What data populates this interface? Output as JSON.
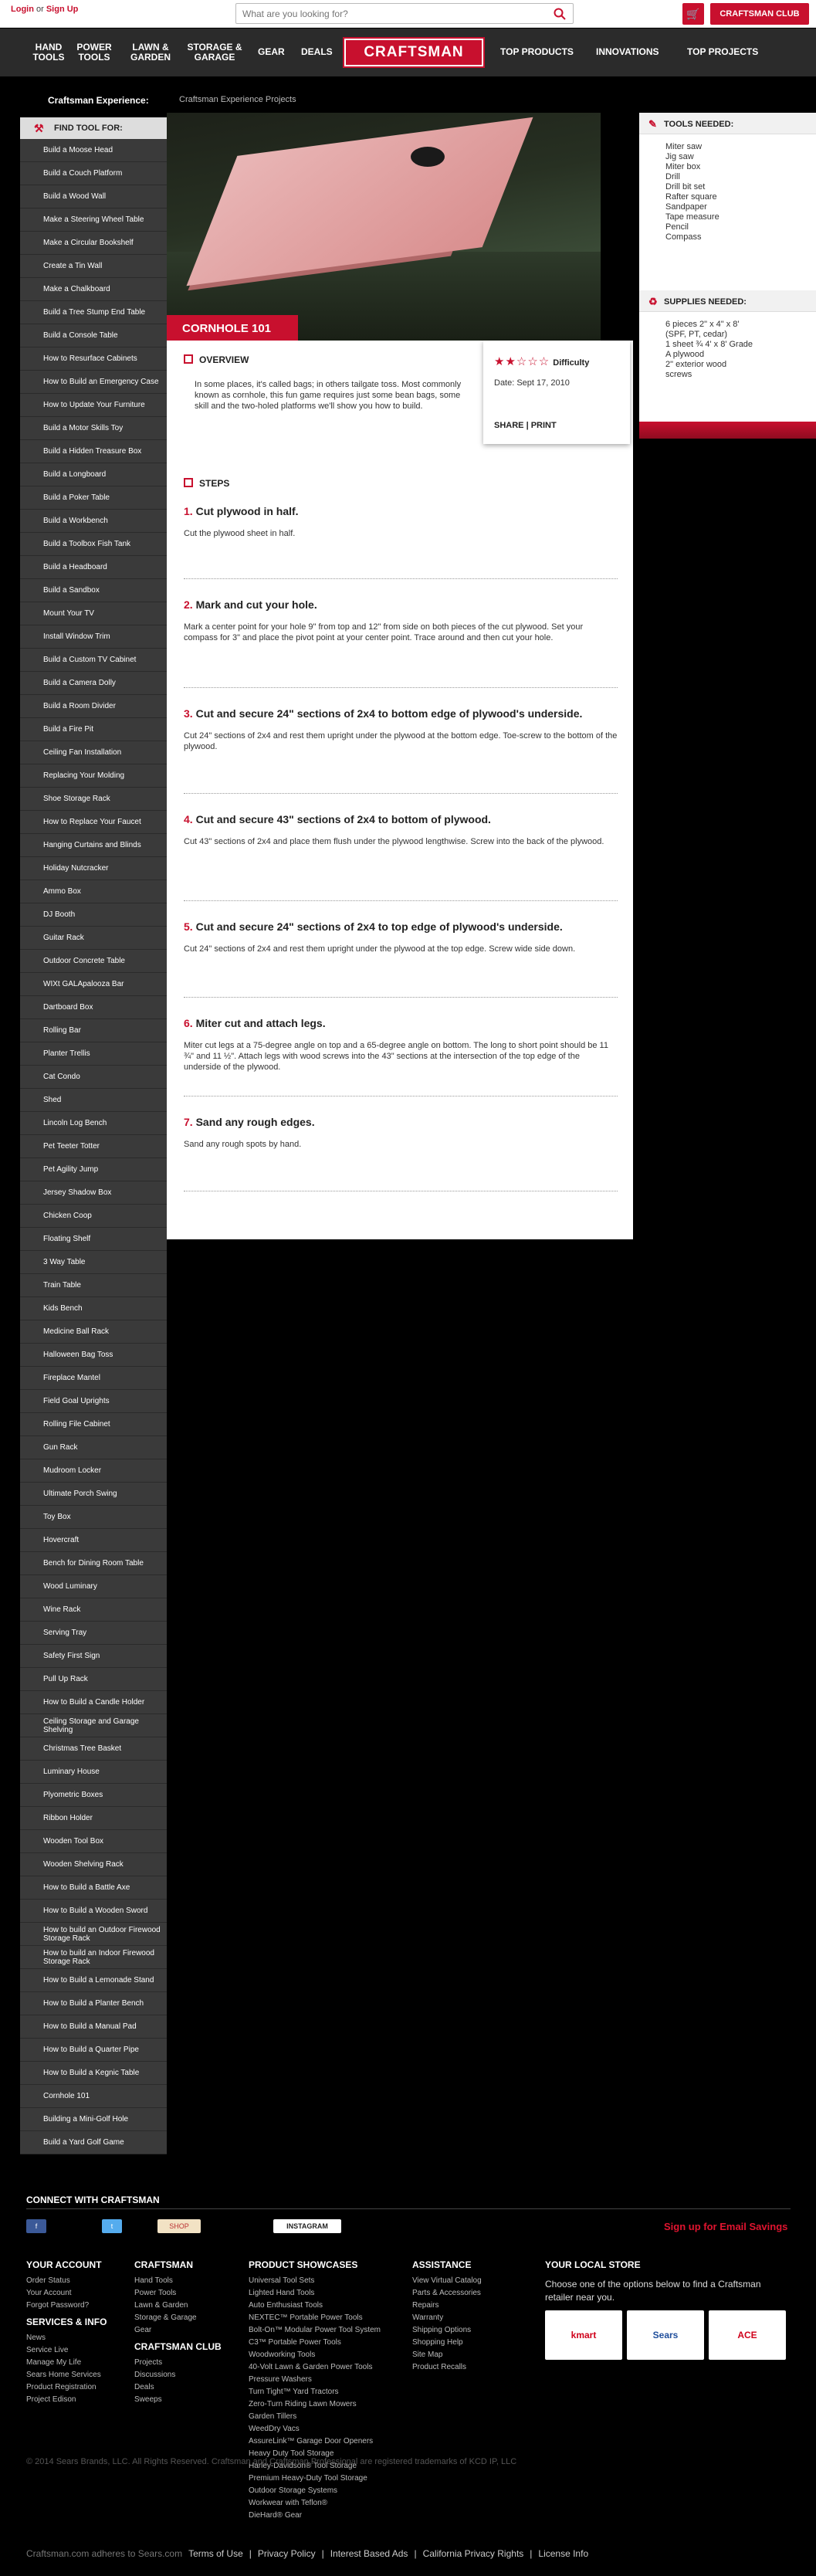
{
  "header": {
    "login": "Login",
    "or": "or",
    "signup": "Sign Up",
    "search_placeholder": "What are you looking for?",
    "club": "CRAFTSMAN CLUB"
  },
  "nav": {
    "hand_tools": "HAND TOOLS",
    "power_tools": "POWER TOOLS",
    "lawn_garden": "LAWN & GARDEN",
    "storage_garage": "STORAGE & GARAGE",
    "gear": "GEAR",
    "deals": "DEALS",
    "logo": "CRAFTSMAN",
    "top_products": "TOP PRODUCTS",
    "innovations": "INNOVATIONS",
    "top_projects": "TOP PROJECTS"
  },
  "subnav": {
    "title": "Craftsman Experience:",
    "link": "Craftsman Experience Projects"
  },
  "sidebar": {
    "heading": "FIND TOOL FOR:",
    "items": [
      "Build a Moose Head",
      "Build a Couch Platform",
      "Build a Wood Wall",
      "Make a Steering Wheel Table",
      "Make a Circular Bookshelf",
      "Create a Tin Wall",
      "Make a Chalkboard",
      "Build a Tree Stump End Table",
      "Build a Console Table",
      "How to Resurface Cabinets",
      "How to Build an Emergency Case",
      "How to Update Your Furniture",
      "Build a Motor Skills Toy",
      "Build a Hidden Treasure Box",
      "Build a Longboard",
      "Build a Poker Table",
      "Build a Workbench",
      "Build a Toolbox Fish Tank",
      "Build a Headboard",
      "Build a Sandbox",
      "Mount Your TV",
      "Install Window Trim",
      "Build a Custom TV Cabinet",
      "Build a Camera Dolly",
      "Build a Room Divider",
      "Build a Fire Pit",
      "Ceiling Fan Installation",
      "Replacing Your Molding",
      "Shoe Storage Rack",
      "How to Replace Your Faucet",
      "Hanging Curtains and Blinds",
      "Holiday Nutcracker",
      "Ammo Box",
      "DJ Booth",
      "Guitar Rack",
      "Outdoor Concrete Table",
      "WIXt GALApalooza Bar",
      "Dartboard Box",
      "Rolling Bar",
      "Planter Trellis",
      "Cat Condo",
      "Shed",
      "Lincoln Log Bench",
      "Pet Teeter Totter",
      "Pet Agility Jump",
      "Jersey Shadow Box",
      "Chicken Coop",
      "Floating Shelf",
      "3 Way Table",
      "Train Table",
      "Kids Bench",
      "Medicine Ball Rack",
      "Halloween Bag Toss",
      "Fireplace Mantel",
      "Field Goal Uprights",
      "Rolling File Cabinet",
      "Gun Rack",
      "Mudroom Locker",
      "Ultimate Porch Swing",
      "Toy Box",
      "Hovercraft",
      "Bench for Dining Room Table",
      "Wood Luminary",
      "Wine Rack",
      "Serving Tray",
      "Safety First Sign",
      "Pull Up Rack",
      "How to Build a Candle Holder",
      "Ceiling Storage and Garage Shelving",
      "Christmas Tree Basket",
      "Luminary House",
      "Plyometric Boxes",
      "Ribbon Holder",
      "Wooden Tool Box",
      "Wooden Shelving Rack",
      "How to Build a Battle Axe",
      "How to Build a Wooden Sword",
      "How to build an Outdoor Firewood Storage Rack",
      "How to build an Indoor Firewood Storage Rack",
      "How to Build a Lemonade Stand",
      "How to Build a Planter Bench",
      "How to Build a Manual Pad",
      "How to Build a Quarter Pipe",
      "How to Build a Kegnic Table",
      "Cornhole 101",
      "Building a Mini-Golf Hole",
      "Build a Yard Golf Game"
    ]
  },
  "project": {
    "title": "CORNHOLE 101",
    "overview_heading": "OVERVIEW",
    "overview_text": "In some places, it's called bags; in others tailgate toss. Most commonly known as cornhole, this fun game requires just some bean bags, some skill and the two-holed platforms we'll show you how to build.",
    "difficulty_label": "Difficulty",
    "difficulty_stars": "★★☆☆☆",
    "date": "Date: Sept 17, 2010",
    "share": "SHARE",
    "separator": "|",
    "print": "PRINT",
    "steps_heading": "STEPS",
    "steps": [
      {
        "num": "1.",
        "title": "Cut plywood in half.",
        "desc": "Cut the plywood sheet in half."
      },
      {
        "num": "2.",
        "title": "Mark and cut your hole.",
        "desc": "Mark a center point for your hole 9\" from top and 12\" from side on both pieces of the cut plywood. Set your compass for 3\" and place the pivot point at your center point. Trace around and then cut your hole."
      },
      {
        "num": "3.",
        "title": "Cut and secure 24\" sections of 2x4 to bottom edge of plywood's underside.",
        "desc": "Cut 24\" sections of 2x4 and rest them upright under the plywood at the bottom edge. Toe-screw to the bottom of the plywood."
      },
      {
        "num": "4.",
        "title": "Cut and secure 43\" sections of 2x4 to bottom of plywood.",
        "desc": "Cut 43\" sections of 2x4 and place them flush under the plywood lengthwise. Screw into the back of the plywood."
      },
      {
        "num": "5.",
        "title": "Cut and secure 24\" sections of 2x4 to top edge of plywood's underside.",
        "desc": "Cut 24\" sections of 2x4 and rest them upright under the plywood at the top edge. Screw wide side down."
      },
      {
        "num": "6.",
        "title": "Miter cut and attach legs.",
        "desc": "Miter cut legs at a 75-degree angle on top and a 65-degree angle on bottom. The long to short point should be 11 ¾\" and 11 ½\". Attach legs with wood screws into the 43\" sections at the intersection of the top edge of the underside of the plywood."
      },
      {
        "num": "7.",
        "title": "Sand any rough edges.",
        "desc": "Sand any rough spots by hand."
      }
    ]
  },
  "tools": {
    "heading": "TOOLS NEEDED:",
    "items": [
      "Miter saw",
      "Jig saw",
      "Miter box",
      "Drill",
      "Drill bit set",
      "Rafter square",
      "Sandpaper",
      "Tape measure",
      "Pencil",
      "Compass"
    ]
  },
  "supplies": {
    "heading": "SUPPLIES NEEDED:",
    "items": [
      "6 pieces 2\" x 4\" x 8'",
      "(SPF, PT, cedar)",
      "1 sheet ¾ 4' x 8' Grade",
      "A plywood",
      "2\" exterior wood",
      "screws"
    ]
  },
  "footer": {
    "connect": "CONNECT WITH CRAFTSMAN",
    "social": [
      "f",
      "t",
      "SHOP",
      "INSTAGRAM"
    ],
    "email_signup": "Sign up for Email Savings",
    "your_account": {
      "heading": "YOUR ACCOUNT",
      "links": [
        "Order Status",
        "Your Account",
        "Forgot Password?"
      ]
    },
    "services": {
      "heading": "SERVICES & INFO",
      "links": [
        "News",
        "Service Live",
        "Manage My Life",
        "Sears Home Services",
        "Product Registration",
        "Project Edison"
      ]
    },
    "craftsman": {
      "heading": "CRAFTSMAN",
      "links": [
        "Hand Tools",
        "Power Tools",
        "Lawn & Garden",
        "Storage & Garage",
        "Gear"
      ]
    },
    "club": {
      "heading": "CRAFTSMAN CLUB",
      "links": [
        "Projects",
        "Discussions",
        "Deals",
        "Sweeps"
      ]
    },
    "showcases": {
      "heading": "PRODUCT SHOWCASES",
      "links": [
        "Universal Tool Sets",
        "Lighted Hand Tools",
        "Auto Enthusiast Tools",
        "NEXTEC™ Portable Power Tools",
        "Bolt-On™ Modular Power Tool System",
        "C3™ Portable Power Tools",
        "Woodworking Tools",
        "40-Volt Lawn & Garden Power Tools",
        "Pressure Washers",
        "Turn Tight™ Yard Tractors",
        "Zero-Turn Riding Lawn Mowers",
        "Garden Tillers",
        "WeedDry Vacs",
        "AssureLink™ Garage Door Openers",
        "Heavy Duty Tool Storage",
        "Harley-Davidson® Tool Storage",
        "Premium Heavy-Duty Tool Storage",
        "Outdoor Storage Systems",
        "Workwear with Teflon®",
        "DieHard® Gear"
      ]
    },
    "assistance": {
      "heading": "ASSISTANCE",
      "links": [
        "View Virtual Catalog",
        "Parts & Accessories",
        "Repairs",
        "Warranty",
        "Shipping Options",
        "Shopping Help",
        "Site Map",
        "Product Recalls"
      ]
    },
    "local_store": {
      "heading": "YOUR LOCAL STORE",
      "text": "Choose one of the options below to find a Craftsman retailer near you."
    },
    "stores": [
      "kmart",
      "Sears",
      "ACE"
    ],
    "copyright": "© 2014 Sears Brands, LLC. All Rights Reserved. Craftsman and Craftsman Professional are registered trademarks of KCD IP, LLC",
    "legal": [
      "Craftsman.com adheres to Sears.com",
      "Terms of Use",
      "|",
      "Privacy Policy",
      "|",
      "Interest Based Ads",
      "|",
      "California Privacy Rights",
      "|",
      "License Info"
    ]
  },
  "colors": {
    "accent": "#c8102e",
    "nav_bg": "#2b2b2b",
    "sidebar_bg": "#3a3a3a"
  }
}
